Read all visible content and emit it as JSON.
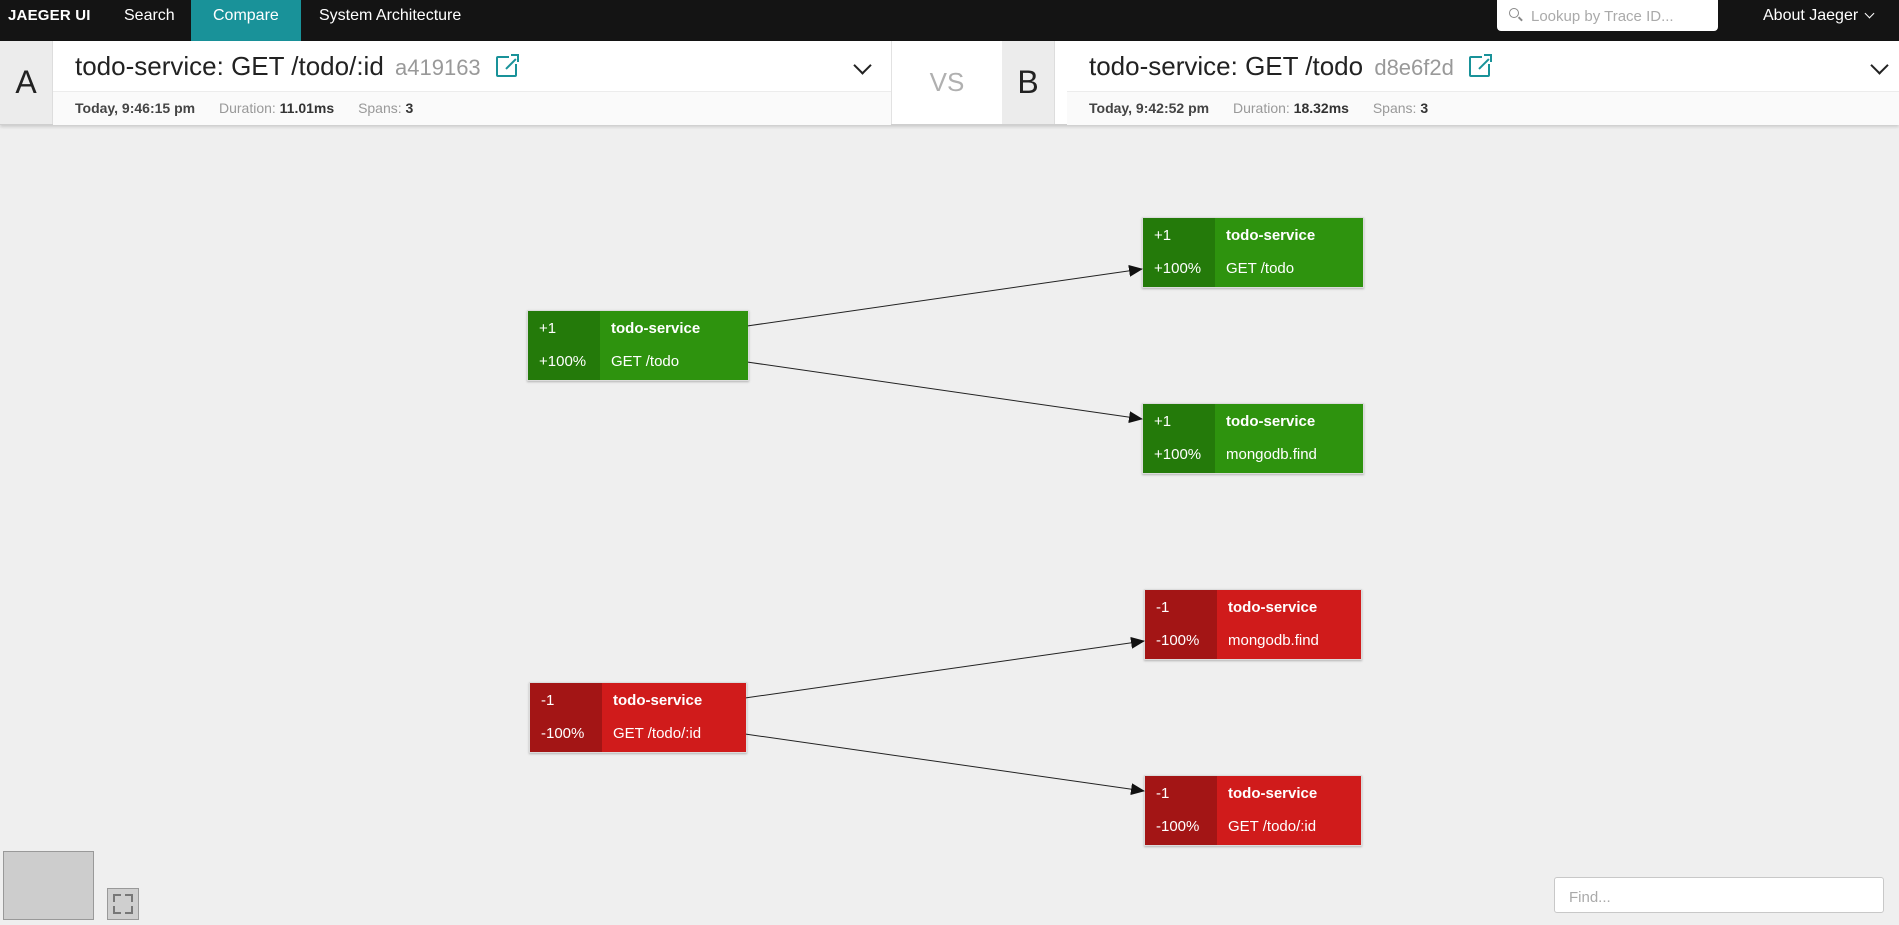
{
  "nav": {
    "brand": "JAEGER UI",
    "items": [
      {
        "label": "Search"
      },
      {
        "label": "Compare"
      },
      {
        "label": "System Architecture"
      }
    ],
    "lookup_placeholder": "Lookup by Trace ID...",
    "about": "About Jaeger"
  },
  "compare": {
    "vs": "VS",
    "a": {
      "letter": "A",
      "title": "todo-service: GET /todo/:id",
      "trace_id": "a419163",
      "when": "Today, 9:46:15 pm",
      "duration_label": "Duration:",
      "duration": "11.01ms",
      "spans_label": "Spans:",
      "spans": "3"
    },
    "b": {
      "letter": "B",
      "title": "todo-service: GET /todo",
      "trace_id": "d8e6f2d",
      "when": "Today, 9:42:52 pm",
      "duration_label": "Duration:",
      "duration": "18.32ms",
      "spans_label": "Spans:",
      "spans": "3"
    }
  },
  "graph": {
    "nodes": [
      {
        "id": "n1",
        "kind": "added",
        "count": "+1",
        "pct": "+100%",
        "service": "todo-service",
        "operation": "GET /todo"
      },
      {
        "id": "n2",
        "kind": "added",
        "count": "+1",
        "pct": "+100%",
        "service": "todo-service",
        "operation": "GET /todo"
      },
      {
        "id": "n3",
        "kind": "added",
        "count": "+1",
        "pct": "+100%",
        "service": "todo-service",
        "operation": "mongodb.find"
      },
      {
        "id": "n4",
        "kind": "removed",
        "count": "-1",
        "pct": "-100%",
        "service": "todo-service",
        "operation": "GET /todo/:id"
      },
      {
        "id": "n5",
        "kind": "removed",
        "count": "-1",
        "pct": "-100%",
        "service": "todo-service",
        "operation": "mongodb.find"
      },
      {
        "id": "n6",
        "kind": "removed",
        "count": "-1",
        "pct": "-100%",
        "service": "todo-service",
        "operation": "GET /todo/:id"
      }
    ],
    "edges": [
      {
        "from": "n1",
        "to": "n2"
      },
      {
        "from": "n1",
        "to": "n3"
      },
      {
        "from": "n4",
        "to": "n5"
      },
      {
        "from": "n4",
        "to": "n6"
      }
    ]
  },
  "find_placeholder": "Find..."
}
